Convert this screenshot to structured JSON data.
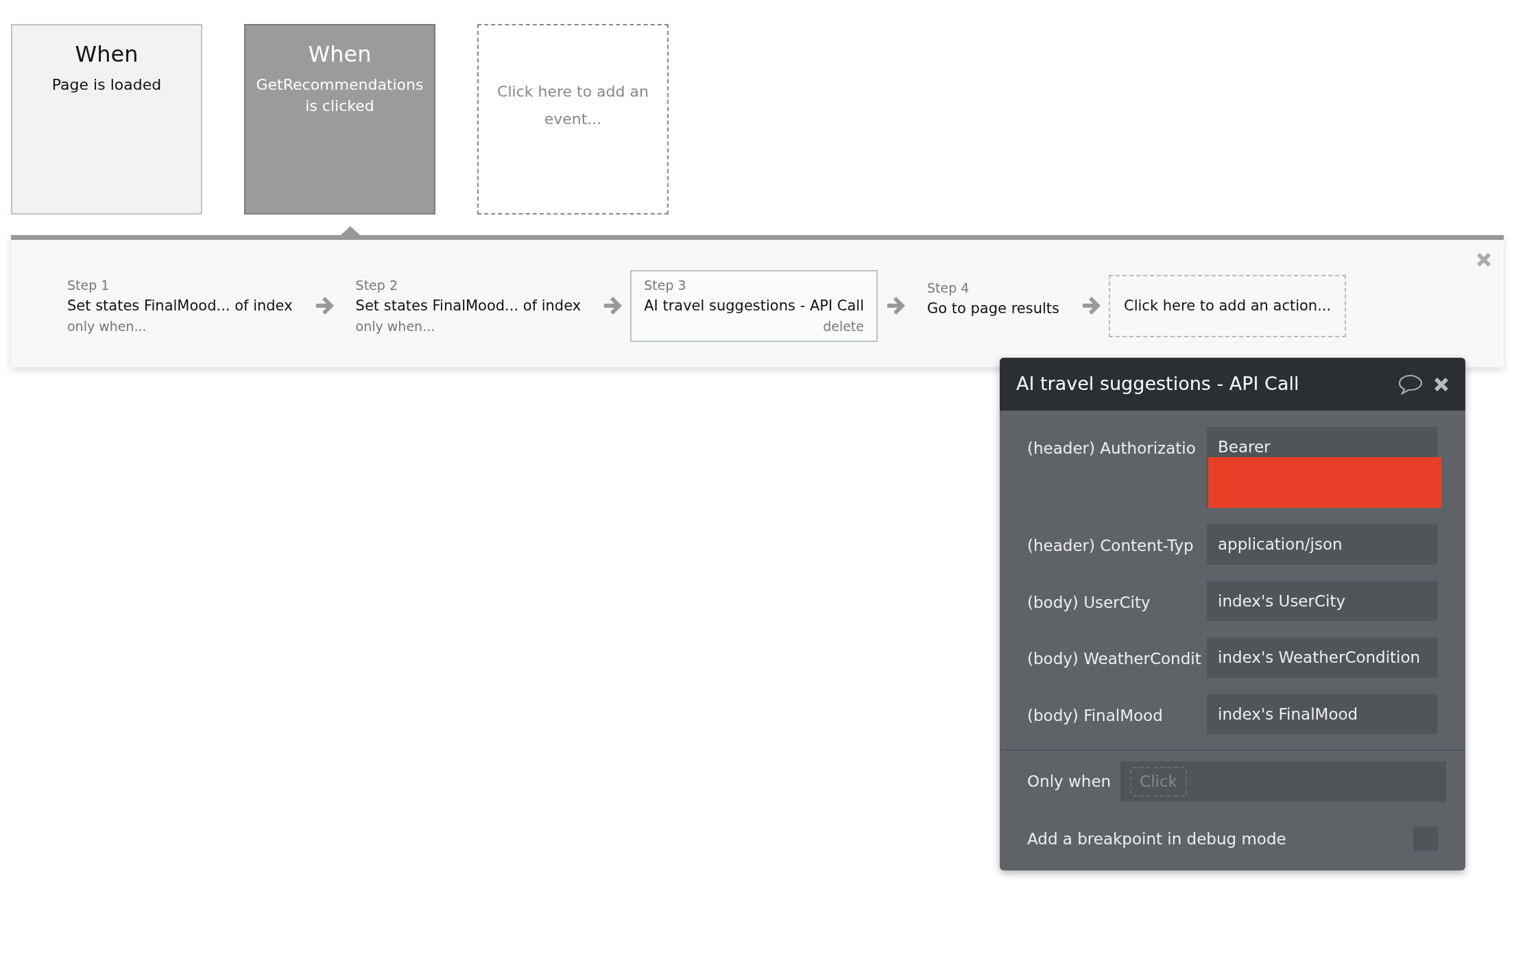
{
  "events": [
    {
      "kind": "event",
      "title": "When",
      "trigger": "Page is loaded",
      "selected": false
    },
    {
      "kind": "event",
      "title": "When",
      "trigger": "GetRecommendations is clicked",
      "selected": true
    },
    {
      "kind": "add",
      "label": "Click here to add an event..."
    }
  ],
  "steps": [
    {
      "kind": "step",
      "label": "Step 1",
      "title": "Set states FinalMood... of index",
      "condition": "only when...",
      "selected": false
    },
    {
      "kind": "step",
      "label": "Step 2",
      "title": "Set states FinalMood... of index",
      "condition": "only when...",
      "selected": false
    },
    {
      "kind": "step",
      "label": "Step 3",
      "title": "AI travel suggestions - API Call",
      "delete": "delete",
      "selected": true
    },
    {
      "kind": "step",
      "label": "Step 4",
      "title": "Go to page results",
      "selected": false
    },
    {
      "kind": "add",
      "label": "Click here to add an action..."
    }
  ],
  "popup": {
    "title": "AI travel suggestions - API Call",
    "fields": [
      {
        "label": "(header) Authorizatio",
        "value": "Bearer",
        "redacted": true
      },
      {
        "label": "(header) Content-Typ",
        "value": "application/json",
        "redacted": false
      },
      {
        "label": "(body) UserCity",
        "value": "index's UserCity",
        "redacted": false
      },
      {
        "label": "(body) WeatherCondit",
        "value": "index's WeatherCondition",
        "redacted": false
      },
      {
        "label": "(body) FinalMood",
        "value": "index's FinalMood",
        "redacted": false
      }
    ],
    "only_when": {
      "label": "Only when",
      "placeholder": "Click"
    },
    "breakpoint": {
      "label": "Add a breakpoint in debug mode",
      "checked": false
    }
  }
}
